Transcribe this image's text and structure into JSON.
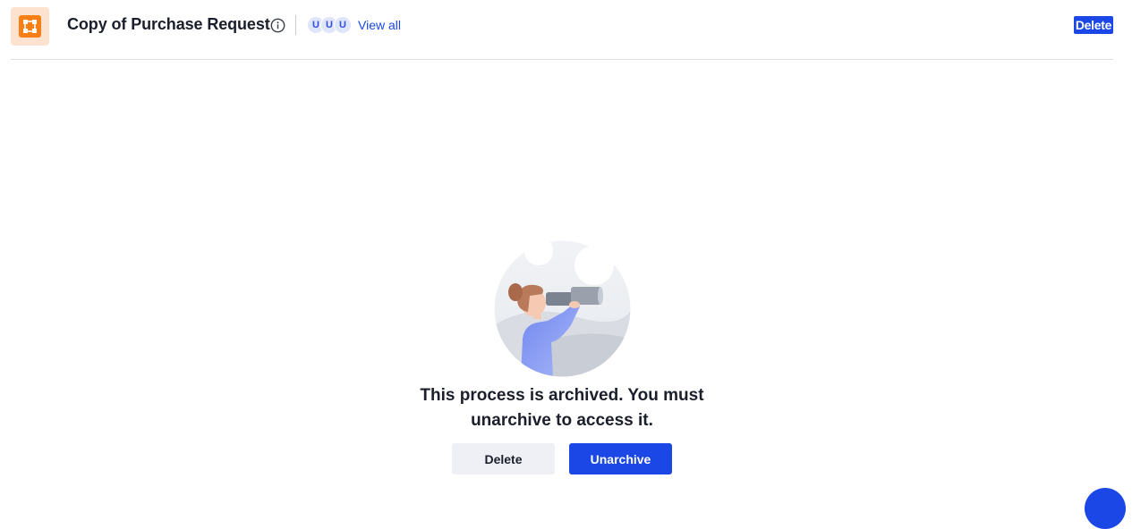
{
  "header": {
    "title": "Copy of Purchase Request",
    "avatars": [
      "U",
      "U",
      "U"
    ],
    "view_all_label": "View all",
    "delete_label": "Delete"
  },
  "main": {
    "message_line1": "This process is archived. You must",
    "message_line2": "unarchive to access it.",
    "delete_button_label": "Delete",
    "unarchive_button_label": "Unarchive"
  },
  "colors": {
    "accent": "#1a47e5",
    "app_icon": "#f97e14",
    "app_icon_bg": "#fde3cf"
  },
  "icons": {
    "app": "process-icon",
    "info": "info-icon",
    "illustration": "binoculars-illustration",
    "fab": "chat-icon"
  }
}
